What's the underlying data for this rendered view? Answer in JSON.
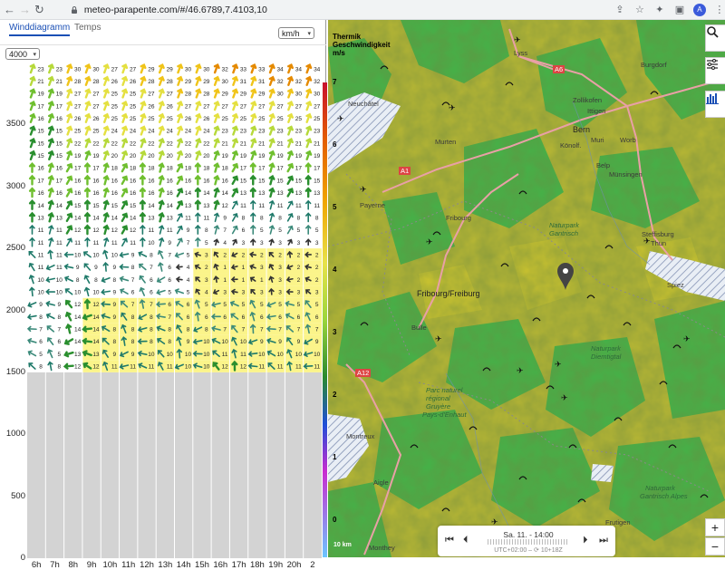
{
  "browser": {
    "url": "meteo-parapente.com/#/46.6789,7.4103,10",
    "back_icon": "arrow-left-icon",
    "forward_icon": "arrow-right-icon",
    "reload_icon": "reload-icon",
    "avatar_letter": "A"
  },
  "tabs": [
    {
      "label": "Winddiagramm",
      "active": true
    },
    {
      "label": "Temps",
      "active": false
    }
  ],
  "unit_select": {
    "value": "km/h"
  },
  "altitude_select": {
    "value": "4000"
  },
  "y_axis": {
    "ticks": [
      "3500",
      "3000",
      "2500",
      "2000",
      "1500",
      "1000",
      "500",
      "0"
    ]
  },
  "x_axis": {
    "ticks": [
      "6h",
      "7h",
      "8h",
      "9h",
      "10h",
      "11h",
      "12h",
      "13h",
      "14h",
      "15h",
      "16h",
      "17h",
      "18h",
      "19h",
      "20h",
      "2"
    ]
  },
  "chart_data": {
    "type": "table",
    "title": "",
    "xlabel": "",
    "ylabel": "",
    "ylim": [
      0,
      4000
    ],
    "ground_level": 1500,
    "columns": [
      "6h",
      "7h",
      "8h",
      "9h",
      "10h",
      "11h",
      "12h",
      "13h",
      "14h",
      "15h",
      "16h",
      "17h",
      "18h",
      "19h",
      "20h",
      "2"
    ],
    "levels": [
      3950,
      3850,
      3750,
      3650,
      3550,
      3450,
      3350,
      3250,
      3150,
      3050,
      2950,
      2850,
      2750,
      2650,
      2550,
      2450,
      2350,
      2250,
      2150,
      2050,
      1950,
      1850,
      1750,
      1650,
      1550
    ],
    "cell_values": [
      [
        23,
        23,
        30,
        30,
        27,
        27,
        29,
        29,
        30,
        30,
        32,
        33,
        33,
        34,
        34,
        34
      ],
      [
        21,
        21,
        28,
        28,
        26,
        26,
        28,
        28,
        29,
        29,
        30,
        31,
        31,
        32,
        32,
        32
      ],
      [
        19,
        19,
        27,
        27,
        25,
        25,
        27,
        27,
        28,
        28,
        29,
        29,
        29,
        30,
        30,
        30
      ],
      [
        17,
        17,
        27,
        27,
        25,
        25,
        26,
        26,
        27,
        27,
        27,
        27,
        27,
        27,
        27,
        27
      ],
      [
        16,
        16,
        26,
        26,
        25,
        25,
        25,
        25,
        26,
        26,
        25,
        25,
        25,
        25,
        25,
        25
      ],
      [
        15,
        15,
        25,
        25,
        24,
        24,
        24,
        24,
        24,
        24,
        23,
        23,
        23,
        23,
        23,
        23
      ],
      [
        15,
        15,
        22,
        22,
        22,
        22,
        22,
        22,
        22,
        22,
        21,
        21,
        21,
        21,
        21,
        21
      ],
      [
        15,
        15,
        19,
        19,
        20,
        20,
        20,
        20,
        20,
        20,
        19,
        19,
        19,
        19,
        19,
        19
      ],
      [
        16,
        16,
        17,
        17,
        18,
        18,
        18,
        18,
        18,
        18,
        18,
        17,
        17,
        17,
        17,
        17
      ],
      [
        17,
        17,
        16,
        16,
        16,
        16,
        16,
        16,
        16,
        16,
        16,
        15,
        15,
        15,
        15,
        15
      ],
      [
        16,
        16,
        16,
        16,
        16,
        16,
        16,
        16,
        14,
        14,
        14,
        13,
        13,
        13,
        13,
        13
      ],
      [
        14,
        14,
        15,
        15,
        15,
        15,
        14,
        14,
        13,
        13,
        12,
        11,
        11,
        11,
        11,
        11
      ],
      [
        13,
        13,
        14,
        14,
        14,
        14,
        13,
        13,
        11,
        11,
        9,
        8,
        8,
        8,
        8,
        8
      ],
      [
        11,
        11,
        12,
        12,
        12,
        12,
        11,
        11,
        9,
        8,
        7,
        6,
        5,
        5,
        5,
        5
      ],
      [
        11,
        11,
        11,
        11,
        11,
        11,
        10,
        9,
        7,
        5,
        4,
        3,
        3,
        3,
        3,
        3
      ],
      [
        11,
        11,
        10,
        10,
        10,
        9,
        8,
        7,
        5,
        3,
        2,
        2,
        2,
        2,
        2,
        2
      ],
      [
        11,
        11,
        9,
        9,
        9,
        8,
        7,
        6,
        4,
        2,
        1,
        1,
        3,
        3,
        2,
        2
      ],
      [
        10,
        10,
        8,
        8,
        8,
        7,
        6,
        6,
        4,
        3,
        1,
        1,
        1,
        3,
        2,
        2
      ],
      [
        10,
        10,
        10,
        10,
        9,
        6,
        6,
        5,
        5,
        4,
        3,
        3,
        3,
        3,
        3,
        3
      ],
      [
        9,
        9,
        12,
        12,
        9,
        7,
        7,
        6,
        6,
        5,
        5,
        5,
        5,
        5,
        5,
        5
      ],
      [
        8,
        8,
        14,
        14,
        9,
        8,
        8,
        7,
        6,
        6,
        6,
        6,
        6,
        6,
        6,
        6
      ],
      [
        7,
        7,
        14,
        14,
        8,
        8,
        8,
        8,
        8,
        8,
        7,
        7,
        7,
        7,
        7,
        7
      ],
      [
        6,
        6,
        14,
        14,
        8,
        8,
        8,
        8,
        9,
        10,
        10,
        10,
        9,
        9,
        9,
        9
      ],
      [
        5,
        5,
        13,
        13,
        9,
        9,
        10,
        10,
        10,
        10,
        11,
        11,
        10,
        10,
        10,
        10
      ],
      [
        8,
        8,
        12,
        12,
        11,
        11,
        11,
        11,
        10,
        10,
        12,
        12,
        11,
        11,
        11,
        11
      ]
    ]
  },
  "map": {
    "legend_title_1": "Thermik",
    "legend_title_2": "Geschwindigkeit",
    "legend_title_3": "m/s",
    "legend_numbers": [
      "7",
      "6",
      "5",
      "4",
      "3",
      "2",
      "1",
      "0"
    ],
    "places": {
      "lyss": "Lyss",
      "a6": "A6",
      "burgdorf": "Burgdorf",
      "neuchatel": "Neuchâtel",
      "zollikofen": "Zollikofen",
      "ittigen": "Ittigen",
      "bern": "Bern",
      "muri": "Muri",
      "worb": "Worb",
      "murten": "Murten",
      "konolfingen": "Könolf.",
      "belp": "Belp",
      "munsingen": "Münsingen",
      "a1": "A1",
      "payerne": "Payerne",
      "fribourg_small": "Fribourg",
      "naturpark_gantrisch_1": "Naturpark",
      "naturpark_gantrisch_2": "Gantrisch",
      "steffisburg": "Steffisburg",
      "thun": "Thun",
      "fribourg_freiburg": "Fribourg/Freiburg",
      "spiez": "Spiez",
      "bulle": "Bulle",
      "naturpark_diemtigtal_1": "Naturpark",
      "naturpark_diemtigtal_2": "Diemtigtal",
      "a12": "A12",
      "gruyere_1": "Parc naturel",
      "gruyere_2": "régional",
      "gruyere_3": "Gruyère",
      "gruyere_4": "Pays-d'Enhaut",
      "montreux": "Montreux",
      "aigle": "Aigle",
      "adelboden_1": "Naturpark",
      "adelboden_2": "Gantrisch Alpes",
      "frutigen": "Frutigen",
      "monthey": "Monthey"
    },
    "scale_label": "10 km",
    "time_label": "Sa. 11. - 14:00",
    "time_sub": "UTC+02:00 – ⟳ 10+18Z",
    "buttons": {
      "search_icon": "search-icon",
      "filter_icon": "sliders-icon",
      "chart_icon": "bar-chart-icon",
      "zoom_in": "+",
      "zoom_out": "−"
    }
  }
}
